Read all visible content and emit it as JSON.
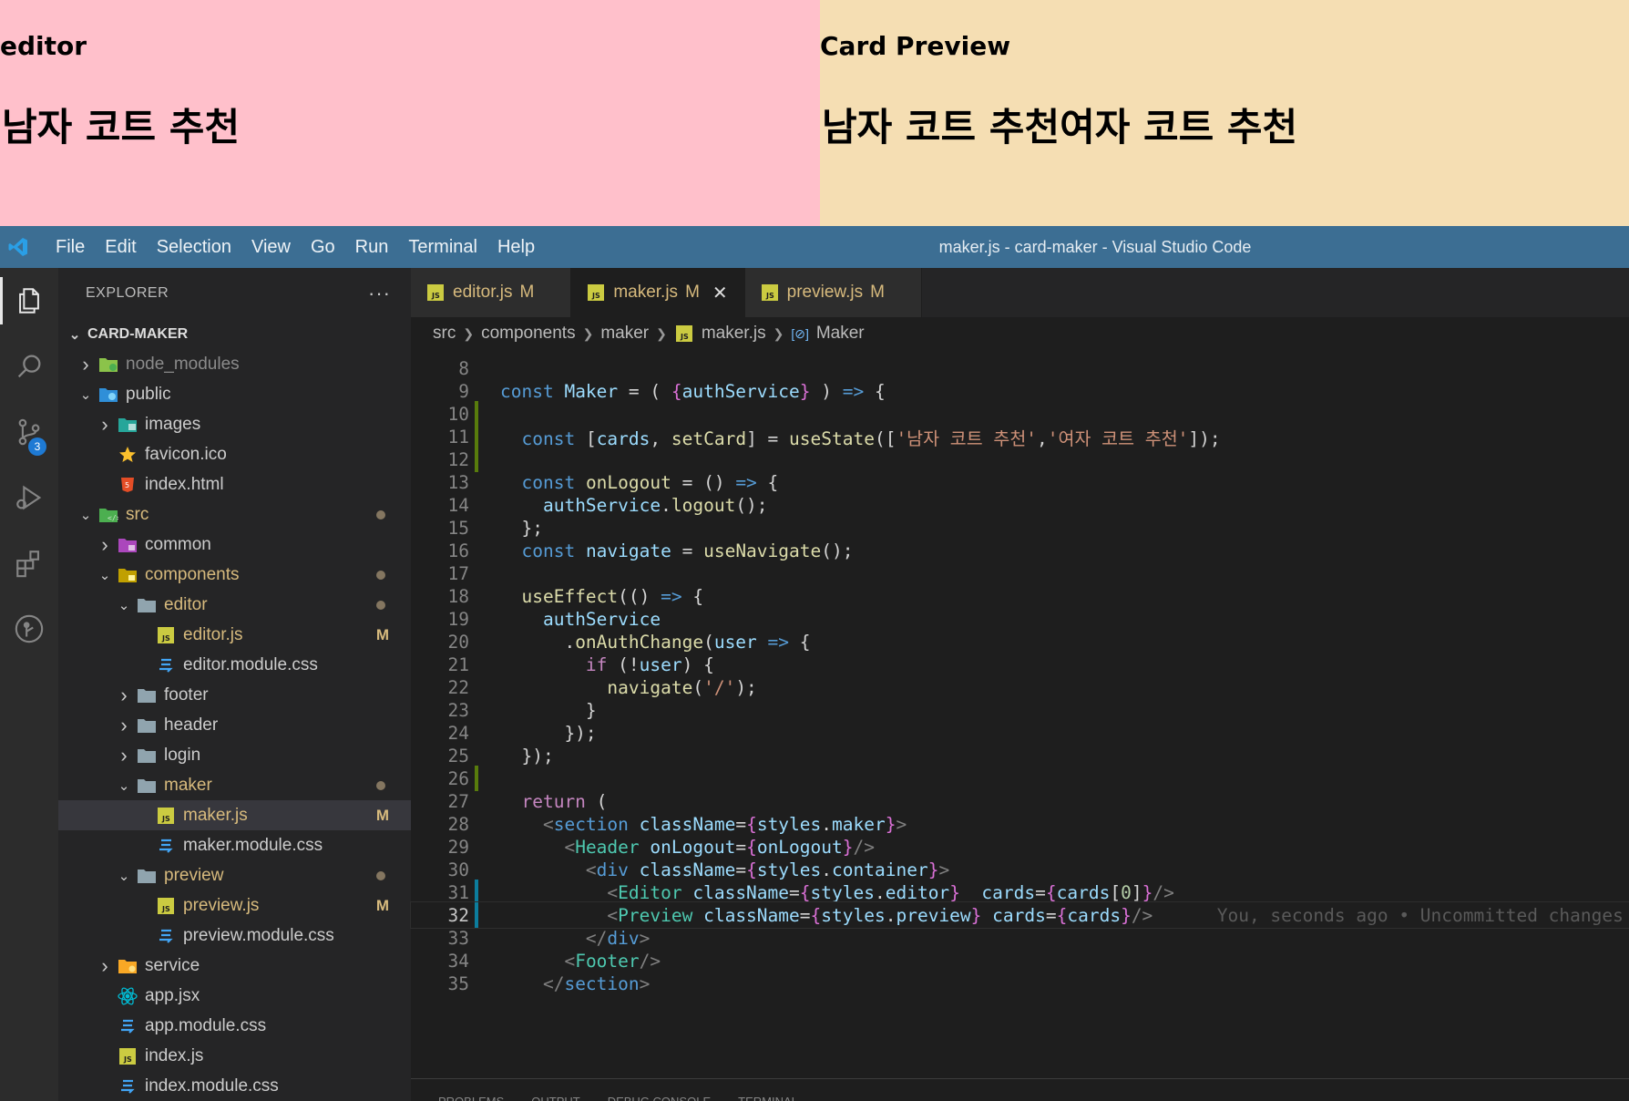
{
  "preview": {
    "editor_heading": "editor",
    "editor_card": "남자 코트 추천",
    "preview_heading": "Card Preview",
    "preview_cards": "남자 코트 추천여자 코트 추천"
  },
  "titlebar": {
    "menu": [
      "File",
      "Edit",
      "Selection",
      "View",
      "Go",
      "Run",
      "Terminal",
      "Help"
    ],
    "window_title": "maker.js - card-maker - Visual Studio Code"
  },
  "activity": {
    "scm_badge": "3"
  },
  "explorer": {
    "title": "EXPLORER",
    "more": "···",
    "root": "CARD-MAKER",
    "rows": [
      {
        "label": "node_modules",
        "depth": 0,
        "chev": "›",
        "icon": "folder-node-icon",
        "color": "dim"
      },
      {
        "label": "public",
        "depth": 0,
        "chev": "⌄",
        "icon": "folder-public-icon",
        "color": "norm"
      },
      {
        "label": "images",
        "depth": 1,
        "chev": "›",
        "icon": "folder-images-icon",
        "color": "norm"
      },
      {
        "label": "favicon.ico",
        "depth": 1,
        "chev": "",
        "icon": "star-icon",
        "color": "norm"
      },
      {
        "label": "index.html",
        "depth": 1,
        "chev": "",
        "icon": "html-icon",
        "color": "norm"
      },
      {
        "label": "src",
        "depth": 0,
        "chev": "⌄",
        "icon": "folder-src-icon",
        "color": "mod",
        "dot": true
      },
      {
        "label": "common",
        "depth": 1,
        "chev": "›",
        "icon": "folder-common-icon",
        "color": "norm"
      },
      {
        "label": "components",
        "depth": 1,
        "chev": "⌄",
        "icon": "folder-components-icon",
        "color": "mod",
        "dot": true
      },
      {
        "label": "editor",
        "depth": 2,
        "chev": "⌄",
        "icon": "folder-icon",
        "color": "mod",
        "dot": true
      },
      {
        "label": "editor.js",
        "depth": 3,
        "chev": "",
        "icon": "js-icon",
        "color": "mod",
        "mod": "M"
      },
      {
        "label": "editor.module.css",
        "depth": 3,
        "chev": "",
        "icon": "css-icon",
        "color": "norm"
      },
      {
        "label": "footer",
        "depth": 2,
        "chev": "›",
        "icon": "folder-icon",
        "color": "norm"
      },
      {
        "label": "header",
        "depth": 2,
        "chev": "›",
        "icon": "folder-icon",
        "color": "norm"
      },
      {
        "label": "login",
        "depth": 2,
        "chev": "›",
        "icon": "folder-icon",
        "color": "norm"
      },
      {
        "label": "maker",
        "depth": 2,
        "chev": "⌄",
        "icon": "folder-icon",
        "color": "mod",
        "dot": true
      },
      {
        "label": "maker.js",
        "depth": 3,
        "chev": "",
        "icon": "js-icon",
        "color": "mod",
        "mod": "M",
        "selected": true
      },
      {
        "label": "maker.module.css",
        "depth": 3,
        "chev": "",
        "icon": "css-icon",
        "color": "norm"
      },
      {
        "label": "preview",
        "depth": 2,
        "chev": "⌄",
        "icon": "folder-icon",
        "color": "mod",
        "dot": true
      },
      {
        "label": "preview.js",
        "depth": 3,
        "chev": "",
        "icon": "js-icon",
        "color": "mod",
        "mod": "M"
      },
      {
        "label": "preview.module.css",
        "depth": 3,
        "chev": "",
        "icon": "css-icon",
        "color": "norm"
      },
      {
        "label": "service",
        "depth": 1,
        "chev": "›",
        "icon": "folder-service-icon",
        "color": "norm"
      },
      {
        "label": "app.jsx",
        "depth": 1,
        "chev": "",
        "icon": "react-icon",
        "color": "norm"
      },
      {
        "label": "app.module.css",
        "depth": 1,
        "chev": "",
        "icon": "css-icon",
        "color": "norm"
      },
      {
        "label": "index.js",
        "depth": 1,
        "chev": "",
        "icon": "js-icon",
        "color": "norm"
      },
      {
        "label": "index.module.css",
        "depth": 1,
        "chev": "",
        "icon": "css-icon",
        "color": "norm"
      }
    ]
  },
  "tabs": [
    {
      "label": "editor.js",
      "mod": "M",
      "active": false
    },
    {
      "label": "maker.js",
      "mod": "M",
      "active": true,
      "close": "✕"
    },
    {
      "label": "preview.js",
      "mod": "M",
      "active": false
    }
  ],
  "breadcrumb": [
    "src",
    "components",
    "maker",
    "maker.js",
    "Maker"
  ],
  "code": {
    "current_line": 32,
    "lines": [
      {
        "n": "8",
        "t": [
          [
            "",
            ""
          ]
        ]
      },
      {
        "n": "9",
        "t": [
          [
            "kw",
            "const "
          ],
          [
            "var",
            "Maker"
          ],
          [
            "op",
            " = ( "
          ],
          [
            "br",
            "{"
          ],
          [
            "var",
            "authService"
          ],
          [
            "br",
            "}"
          ],
          [
            "op",
            " ) "
          ],
          [
            "kw",
            "=>"
          ],
          [
            "op",
            " {"
          ]
        ]
      },
      {
        "n": "10",
        "g": "add",
        "t": [
          [
            "",
            ""
          ]
        ]
      },
      {
        "n": "11",
        "g": "add",
        "t": [
          [
            "op",
            "  "
          ],
          [
            "kw",
            "const "
          ],
          [
            "op",
            "["
          ],
          [
            "var",
            "cards"
          ],
          [
            "op",
            ", "
          ],
          [
            "fn",
            "setCard"
          ],
          [
            "op",
            "] = "
          ],
          [
            "fn",
            "useState"
          ],
          [
            "op",
            "(["
          ],
          [
            "str",
            "'남자 코트 추천'"
          ],
          [
            "op",
            ","
          ],
          [
            "str",
            "'여자 코트 추천'"
          ],
          [
            "op",
            "]);"
          ]
        ]
      },
      {
        "n": "12",
        "g": "add",
        "t": [
          [
            "",
            ""
          ]
        ]
      },
      {
        "n": "13",
        "t": [
          [
            "op",
            "  "
          ],
          [
            "kw",
            "const "
          ],
          [
            "fn",
            "onLogout"
          ],
          [
            "op",
            " = () "
          ],
          [
            "kw",
            "=>"
          ],
          [
            "op",
            " {"
          ]
        ]
      },
      {
        "n": "14",
        "t": [
          [
            "op",
            "    "
          ],
          [
            "var",
            "authService"
          ],
          [
            "op",
            "."
          ],
          [
            "fn",
            "logout"
          ],
          [
            "op",
            "();"
          ]
        ]
      },
      {
        "n": "15",
        "t": [
          [
            "op",
            "  };"
          ]
        ]
      },
      {
        "n": "16",
        "t": [
          [
            "op",
            "  "
          ],
          [
            "kw",
            "const "
          ],
          [
            "var",
            "navigate"
          ],
          [
            "op",
            " = "
          ],
          [
            "fn",
            "useNavigate"
          ],
          [
            "op",
            "();"
          ]
        ]
      },
      {
        "n": "17",
        "t": [
          [
            "",
            ""
          ]
        ]
      },
      {
        "n": "18",
        "t": [
          [
            "op",
            "  "
          ],
          [
            "fn",
            "useEffect"
          ],
          [
            "op",
            "(() "
          ],
          [
            "kw",
            "=>"
          ],
          [
            "op",
            " {"
          ]
        ]
      },
      {
        "n": "19",
        "t": [
          [
            "op",
            "    "
          ],
          [
            "var",
            "authService"
          ]
        ]
      },
      {
        "n": "20",
        "t": [
          [
            "op",
            "      ."
          ],
          [
            "fn",
            "onAuthChange"
          ],
          [
            "op",
            "("
          ],
          [
            "var",
            "user"
          ],
          [
            "op",
            " "
          ],
          [
            "kw",
            "=>"
          ],
          [
            "op",
            " {"
          ]
        ]
      },
      {
        "n": "21",
        "t": [
          [
            "op",
            "        "
          ],
          [
            "ctl",
            "if"
          ],
          [
            "op",
            " (!"
          ],
          [
            "var",
            "user"
          ],
          [
            "op",
            ") {"
          ]
        ]
      },
      {
        "n": "22",
        "t": [
          [
            "op",
            "          "
          ],
          [
            "fn",
            "navigate"
          ],
          [
            "op",
            "("
          ],
          [
            "str",
            "'/'"
          ],
          [
            "op",
            ");"
          ]
        ]
      },
      {
        "n": "23",
        "t": [
          [
            "op",
            "        }"
          ]
        ]
      },
      {
        "n": "24",
        "t": [
          [
            "op",
            "      });"
          ]
        ]
      },
      {
        "n": "25",
        "t": [
          [
            "op",
            "  });"
          ]
        ]
      },
      {
        "n": "26",
        "g": "add",
        "t": [
          [
            "",
            ""
          ]
        ]
      },
      {
        "n": "27",
        "t": [
          [
            "op",
            "  "
          ],
          [
            "ctl",
            "return"
          ],
          [
            "op",
            " ("
          ]
        ]
      },
      {
        "n": "28",
        "t": [
          [
            "op",
            "    "
          ],
          [
            "tagb",
            "<"
          ],
          [
            "tag",
            "section"
          ],
          [
            "op",
            " "
          ],
          [
            "attr",
            "className"
          ],
          [
            "op",
            "="
          ],
          [
            "br",
            "{"
          ],
          [
            "var",
            "styles"
          ],
          [
            "op",
            "."
          ],
          [
            "var",
            "maker"
          ],
          [
            "br",
            "}"
          ],
          [
            "tagb",
            ">"
          ]
        ]
      },
      {
        "n": "29",
        "t": [
          [
            "op",
            "      "
          ],
          [
            "tagb",
            "<"
          ],
          [
            "comp",
            "Header"
          ],
          [
            "op",
            " "
          ],
          [
            "attr",
            "onLogout"
          ],
          [
            "op",
            "="
          ],
          [
            "br",
            "{"
          ],
          [
            "var",
            "onLogout"
          ],
          [
            "br",
            "}"
          ],
          [
            "tagb",
            "/>"
          ]
        ]
      },
      {
        "n": "30",
        "t": [
          [
            "op",
            "        "
          ],
          [
            "tagb",
            "<"
          ],
          [
            "tag",
            "div"
          ],
          [
            "op",
            " "
          ],
          [
            "attr",
            "className"
          ],
          [
            "op",
            "="
          ],
          [
            "br",
            "{"
          ],
          [
            "var",
            "styles"
          ],
          [
            "op",
            "."
          ],
          [
            "var",
            "container"
          ],
          [
            "br",
            "}"
          ],
          [
            "tagb",
            ">"
          ]
        ]
      },
      {
        "n": "31",
        "g": "mod",
        "t": [
          [
            "op",
            "          "
          ],
          [
            "tagb",
            "<"
          ],
          [
            "comp",
            "Editor"
          ],
          [
            "op",
            " "
          ],
          [
            "attr",
            "className"
          ],
          [
            "op",
            "="
          ],
          [
            "br",
            "{"
          ],
          [
            "var",
            "styles"
          ],
          [
            "op",
            "."
          ],
          [
            "var",
            "editor"
          ],
          [
            "br",
            "}"
          ],
          [
            "op",
            "  "
          ],
          [
            "attr",
            "cards"
          ],
          [
            "op",
            "="
          ],
          [
            "br",
            "{"
          ],
          [
            "var",
            "cards"
          ],
          [
            "op",
            "["
          ],
          [
            "num",
            "0"
          ],
          [
            "op",
            "]"
          ],
          [
            "br",
            "}"
          ],
          [
            "tagb",
            "/>"
          ]
        ]
      },
      {
        "n": "32",
        "g": "mod",
        "t": [
          [
            "op",
            "          "
          ],
          [
            "tagb",
            "<"
          ],
          [
            "comp",
            "Preview"
          ],
          [
            "op",
            " "
          ],
          [
            "attr",
            "className"
          ],
          [
            "op",
            "="
          ],
          [
            "br",
            "{"
          ],
          [
            "var",
            "styles"
          ],
          [
            "op",
            "."
          ],
          [
            "var",
            "preview"
          ],
          [
            "br",
            "}"
          ],
          [
            "op",
            " "
          ],
          [
            "attr",
            "cards"
          ],
          [
            "op",
            "="
          ],
          [
            "br",
            "{"
          ],
          [
            "var",
            "cards"
          ],
          [
            "br",
            "}"
          ],
          [
            "tagb",
            "/>"
          ]
        ],
        "blame": "      You, seconds ago • Uncommitted changes"
      },
      {
        "n": "33",
        "t": [
          [
            "op",
            "        "
          ],
          [
            "tagb",
            "</"
          ],
          [
            "tag",
            "div"
          ],
          [
            "tagb",
            ">"
          ]
        ]
      },
      {
        "n": "34",
        "t": [
          [
            "op",
            "      "
          ],
          [
            "tagb",
            "<"
          ],
          [
            "comp",
            "Footer"
          ],
          [
            "tagb",
            "/>"
          ]
        ]
      },
      {
        "n": "35",
        "t": [
          [
            "op",
            "    "
          ],
          [
            "tagb",
            "</"
          ],
          [
            "tag",
            "section"
          ],
          [
            "tagb",
            ">"
          ]
        ]
      }
    ]
  },
  "colors": {
    "kw": "#569cd6",
    "var": "#9cdcfe",
    "fn": "#dcdcaa",
    "str": "#ce9178",
    "op": "#d4d4d4",
    "br": "#da70d6",
    "ctl": "#c586c0",
    "tag": "#569cd6",
    "tagb": "#808080",
    "comp": "#4ec9b0",
    "attr": "#9cdcfe",
    "num": "#b5cea8",
    "gutter_add": "#587c0c",
    "gutter_mod": "#0c7d9d"
  },
  "panel_tabs": [
    "PROBLEMS",
    "OUTPUT",
    "DEBUG CONSOLE",
    "TERMINAL"
  ]
}
